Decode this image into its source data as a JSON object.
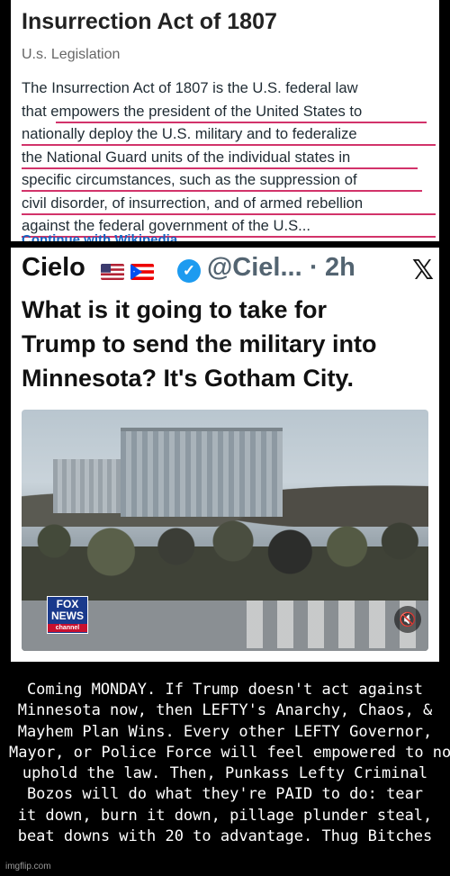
{
  "wiki": {
    "title": "Insurrection Act of 1807",
    "subtitle": "U.s. Legislation",
    "lines": [
      "The Insurrection Act of 1807 is the U.S. federal law",
      "that empowers the president of the United States to",
      "nationally deploy the U.S. military and to federalize",
      "the National Guard units of the individual states in",
      "specific circumstances, such as the suppression of",
      "civil disorder, of insurrection, and of armed rebellion",
      "against the federal government of the U.S..."
    ],
    "more_link": "Continue with Wikipedia",
    "underline_color": "#d2336a"
  },
  "tweet": {
    "name": "Cielo",
    "handle": "@Ciel...",
    "separator": "·",
    "time": "2h",
    "verified_icon": "verified-check-icon",
    "x_logo": "𝕏",
    "text_lines": [
      "What is it going to take for",
      "Trump to send the military into",
      "Minnesota? It's Gotham City."
    ],
    "video": {
      "fox_logo_lines": [
        "FOX",
        "NEWS"
      ],
      "fox_channel": "channel",
      "mute_icon": "🔇"
    }
  },
  "caption_lines": [
    "Coming MONDAY.  If Trump doesn't act against",
    "Minnesota now, then LEFTY's Anarchy, Chaos, &",
    "Mayhem Plan Wins. Every other LEFTY Governor,",
    "Mayor, or Police Force will feel empowered to not",
    "uphold the law.   Then, Punkass Lefty Criminal",
    "Bozos will do what they're PAID to do:  tear",
    "it down, burn it down, pillage plunder steal,",
    "beat downs with 20 to advantage.  Thug Bitches"
  ],
  "watermark": "imgflip.com"
}
